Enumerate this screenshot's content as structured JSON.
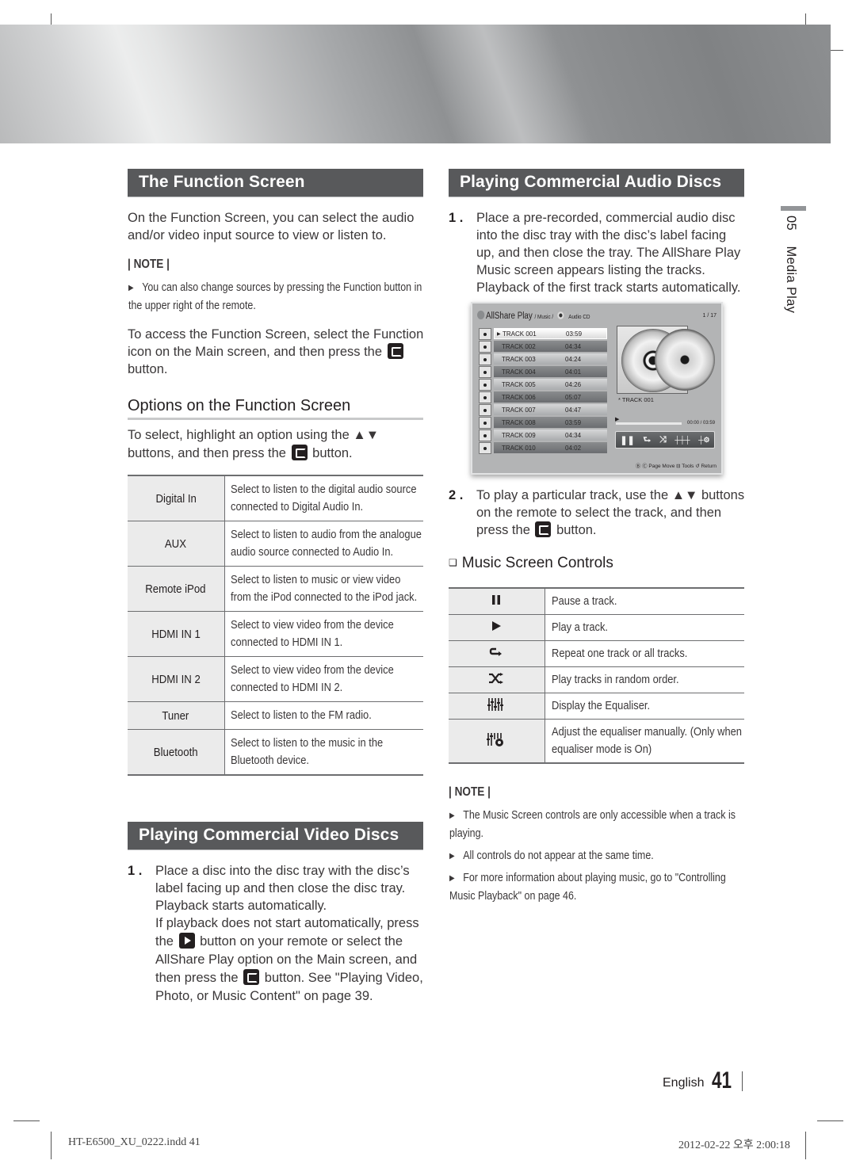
{
  "page": {
    "chapter_number": "05",
    "chapter_title": "Media Play",
    "language": "English",
    "page_number": "41"
  },
  "function_screen": {
    "title": "The Function Screen",
    "intro": "On the Function Screen, you can select the audio and/or video input source to view or listen to.",
    "note_label": "| NOTE |",
    "notes": [
      "You can also change sources by pressing the Function button in the upper right of the remote."
    ],
    "access_text_before": "To access the Function Screen, select the Function icon on the Main screen, and then press the",
    "access_text_after": "button."
  },
  "options": {
    "title": "Options on the Function Screen",
    "instruction_before": "To select, highlight an option using the ▲▼ buttons, and then press the",
    "instruction_after": "button.",
    "rows": [
      {
        "name": "Digital In",
        "desc": "Select to listen to the digital audio source connected to Digital Audio In."
      },
      {
        "name": "AUX",
        "desc": "Select to listen to audio from the analogue audio source connected to Audio In."
      },
      {
        "name": "Remote iPod",
        "desc": "Select to listen to music or view video from the iPod connected to the iPod jack."
      },
      {
        "name": "HDMI IN 1",
        "desc": "Select to view video from the device connected to HDMI IN 1."
      },
      {
        "name": "HDMI IN 2",
        "desc": "Select to view video from the device connected to HDMI IN 2."
      },
      {
        "name": "Tuner",
        "desc": "Select to listen to the FM radio."
      },
      {
        "name": "Bluetooth",
        "desc": "Select to listen to the music in the Bluetooth device."
      }
    ]
  },
  "video_discs": {
    "title": "Playing Commercial Video Discs",
    "step1_num": "1 .",
    "step1_a": "Place a disc into the disc tray with the disc’s label facing up and then close the disc tray. Playback starts automatically.",
    "step1_b_before": "If playback does not start automatically, press the",
    "step1_b_middle": "button on your remote or select the AllShare Play option on the Main screen, and then press the",
    "step1_b_after": "button. See \"Playing Video, Photo, or Music Content\" on page 39."
  },
  "audio_discs": {
    "title": "Playing Commercial Audio Discs",
    "step1_num": "1 .",
    "step1": "Place a pre-recorded, commercial audio disc into the disc tray with the disc’s label facing up, and then close the tray. The AllShare Play Music screen appears listing the tracks. Playback of the first track starts automatically.",
    "step2_num": "2 .",
    "step2_before": "To play a particular track, use the ▲▼ buttons on the remote to select the track, and then press the",
    "step2_after": "button."
  },
  "allshare_screen": {
    "app_name": "AllShare Play",
    "path_music": "/ Music /",
    "path_source": "Audio CD",
    "pager": "1 / 17",
    "tracks": [
      {
        "name": "TRACK 001",
        "time": "03:59",
        "selected": true
      },
      {
        "name": "TRACK 002",
        "time": "04:34"
      },
      {
        "name": "TRACK 003",
        "time": "04:24"
      },
      {
        "name": "TRACK 004",
        "time": "04:01"
      },
      {
        "name": "TRACK 005",
        "time": "04:26"
      },
      {
        "name": "TRACK 006",
        "time": "05:07"
      },
      {
        "name": "TRACK 007",
        "time": "04:47"
      },
      {
        "name": "TRACK 008",
        "time": "03:59"
      },
      {
        "name": "TRACK 009",
        "time": "04:34"
      },
      {
        "name": "TRACK 010",
        "time": "04:02"
      }
    ],
    "now_playing": "* TRACK 001",
    "elapsed": "00:00 / 03:59",
    "progress_fraction": 0.0,
    "footer": "Ⓑ Ⓒ Page Move  ⊟ Tools  ↺ Return"
  },
  "music_controls": {
    "title": "Music Screen Controls",
    "rows": [
      {
        "icon": "pause-icon",
        "glyph": "❚❚",
        "desc": "Pause a track."
      },
      {
        "icon": "play-icon",
        "glyph": "▶",
        "desc": "Play a track."
      },
      {
        "icon": "repeat-icon",
        "glyph": "⮑",
        "desc": "Repeat one track or all tracks."
      },
      {
        "icon": "shuffle-icon",
        "glyph": "⤨",
        "desc": "Play tracks in random order."
      },
      {
        "icon": "equaliser-icon",
        "glyph": "ᚔ",
        "desc": "Display the Equaliser."
      },
      {
        "icon": "equaliser-settings-icon",
        "glyph": "⚙",
        "desc": "Adjust the equaliser manually. (Only when equaliser mode is On)"
      }
    ],
    "note_label": "| NOTE |",
    "notes": [
      "The Music Screen controls are only accessible when a track is playing.",
      "All controls do not appear at the same time.",
      "For more information about playing music, go to \"Controlling Music Playback\" on page 46."
    ]
  },
  "print_info": {
    "file": "HT-E6500_XU_0222.indd   41",
    "timestamp": "2012-02-22   오후 2:00:18"
  }
}
